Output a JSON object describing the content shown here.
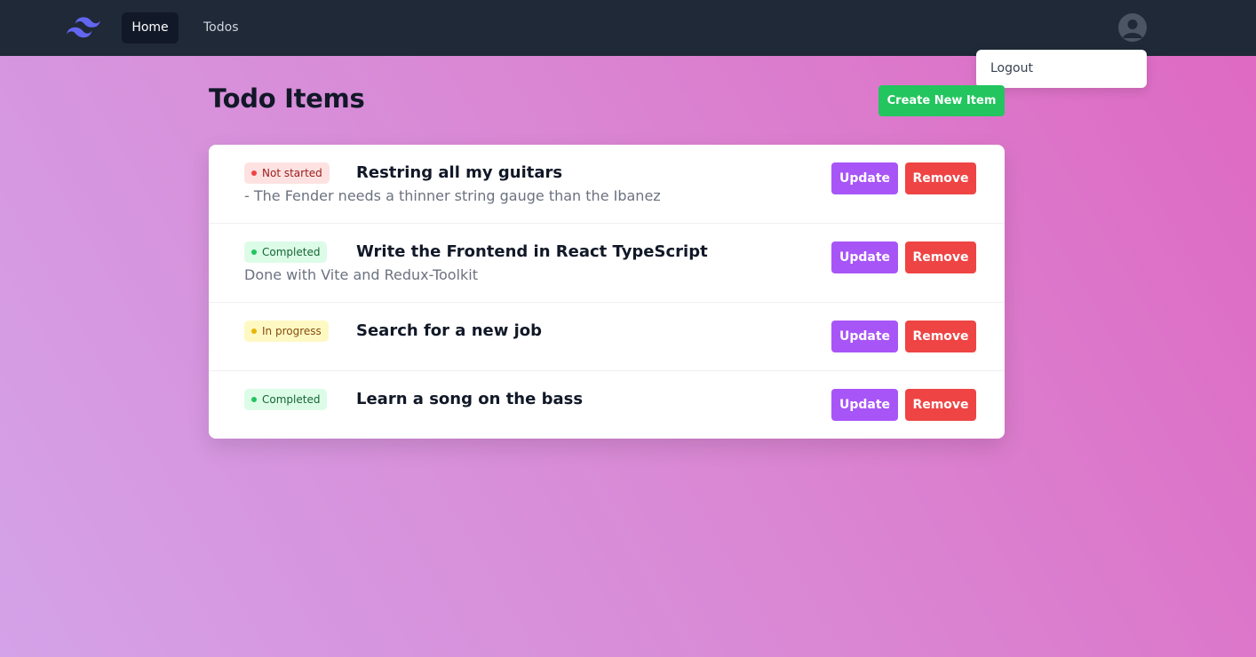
{
  "nav": {
    "logo_icon": "tailwind-logo-icon",
    "links": [
      {
        "label": "Home",
        "active": true
      },
      {
        "label": "Todos",
        "active": false
      }
    ],
    "avatar_icon": "user-avatar-icon"
  },
  "user_menu": {
    "items": [
      {
        "label": "Logout"
      }
    ]
  },
  "main": {
    "title": "Todo Items",
    "create_button": "Create New Item"
  },
  "todos": [
    {
      "status": "Not started",
      "status_color": "red",
      "title": "Restring all my guitars",
      "description": "- The Fender needs a thinner string gauge than the Ibanez",
      "update_label": "Update",
      "remove_label": "Remove"
    },
    {
      "status": "Completed",
      "status_color": "green",
      "title": "Write the Frontend in React TypeScript",
      "description": "Done with Vite and Redux-Toolkit",
      "update_label": "Update",
      "remove_label": "Remove"
    },
    {
      "status": "In progress",
      "status_color": "yellow",
      "title": "Search for a new job",
      "description": "",
      "update_label": "Update",
      "remove_label": "Remove"
    },
    {
      "status": "Completed",
      "status_color": "green",
      "title": "Learn a song on the bass",
      "description": "",
      "update_label": "Update",
      "remove_label": "Remove"
    }
  ],
  "colors": {
    "navbar": "#1f2937",
    "create_button": "#22c55e",
    "update_button": "#a855f7",
    "remove_button": "#ef4444",
    "logo": "#6366f1"
  }
}
